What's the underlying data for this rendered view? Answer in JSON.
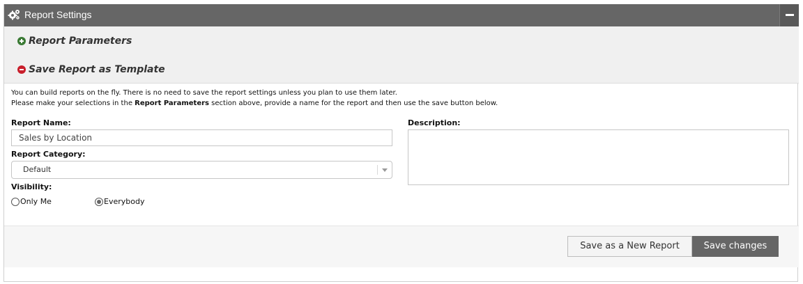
{
  "header": {
    "title": "Report Settings",
    "icon": "gears-icon",
    "collapse_icon": "minus-icon"
  },
  "sections": [
    {
      "label": "Report Parameters",
      "icon": "plus-circle-icon",
      "color": "#3a7a34"
    },
    {
      "label": "Save Report as Template",
      "icon": "minus-circle-icon",
      "color": "#c81e2b"
    }
  ],
  "info": {
    "line1": "You can build reports on the fly. There is no need to save the report settings unless you plan to use them later.",
    "line2_pre": "Please make your selections in the ",
    "line2_bold": "Report Parameters",
    "line2_post": " section above, provide a name for the report and then use the save button below."
  },
  "form": {
    "report_name_label": "Report Name:",
    "report_name_value": "Sales by Location",
    "category_label": "Report Category:",
    "category_value": "Default",
    "visibility_label": "Visibility:",
    "visibility_options": [
      {
        "label": "Only Me",
        "checked": false
      },
      {
        "label": "Everybody",
        "checked": true
      }
    ],
    "description_label": "Description:",
    "description_value": ""
  },
  "footer": {
    "save_new_label": "Save as a New Report",
    "save_changes_label": "Save changes"
  },
  "colors": {
    "header_bg": "#666666",
    "primary_button": "#666666"
  }
}
